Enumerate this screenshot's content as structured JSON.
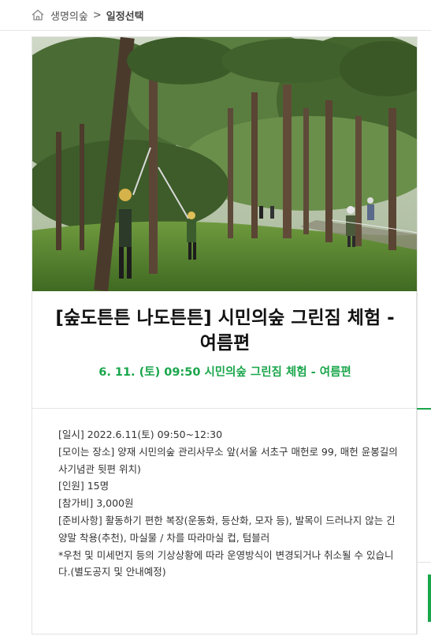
{
  "breadcrumb": {
    "home_icon": "home-icon",
    "parent": "생명의숲",
    "separator": ">",
    "current": "일정선택"
  },
  "program": {
    "image_alt": "숲 속에서 장대 톱으로 가지치기를 하는 참가자들",
    "title": "[숲도튼튼 나도튼튼] 시민의숲 그린짐 체험 - 여름편",
    "session": "6. 11. (토) 09:50 시민의숲 그린짐 체험 - 여름편",
    "details": [
      "[일시] 2022.6.11(토) 09:50~12:30",
      "[모이는 장소] 양재 시민의숲 관리사무소 앞(서울 서초구 매헌로 99, 매헌 윤봉길의사기념관 뒷편 위치)",
      "[인원] 15명",
      "[참가비] 3,000원",
      "[준비사항] 활동하기 편한 복장(운동화, 등산화, 모자 등), 발목이 드러나지 않는 긴양말 착용(추천), 마실물 / 차를 따라마실 컵, 텀블러",
      "*우천 및 미세먼지 등의 기상상황에 따라 운영방식이 변경되거나 취소될 수 있습니다.(별도공지 및 안내예정)"
    ]
  },
  "colors": {
    "accent_green": "#1aa64b",
    "title_text": "#111111",
    "body_text": "#333333"
  }
}
